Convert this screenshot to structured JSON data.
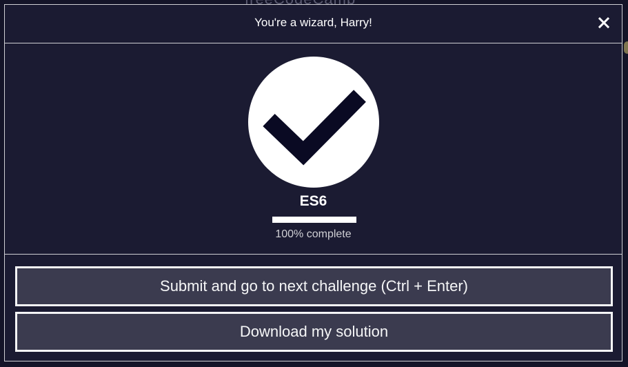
{
  "modal": {
    "title": "You're a wizard, Harry!",
    "close_icon": "close-icon"
  },
  "completion": {
    "icon": "checkmark-icon",
    "certification": "ES6",
    "progress_percent": 100,
    "progress_text": "100% complete"
  },
  "actions": {
    "submit_label": "Submit and go to next challenge (Ctrl + Enter)",
    "download_label": "Download my solution"
  },
  "colors": {
    "modal_bg": "#1b1b32",
    "button_bg": "#3b3b4f",
    "border": "#d0d0d5",
    "check_mark": "#0a0a23"
  }
}
